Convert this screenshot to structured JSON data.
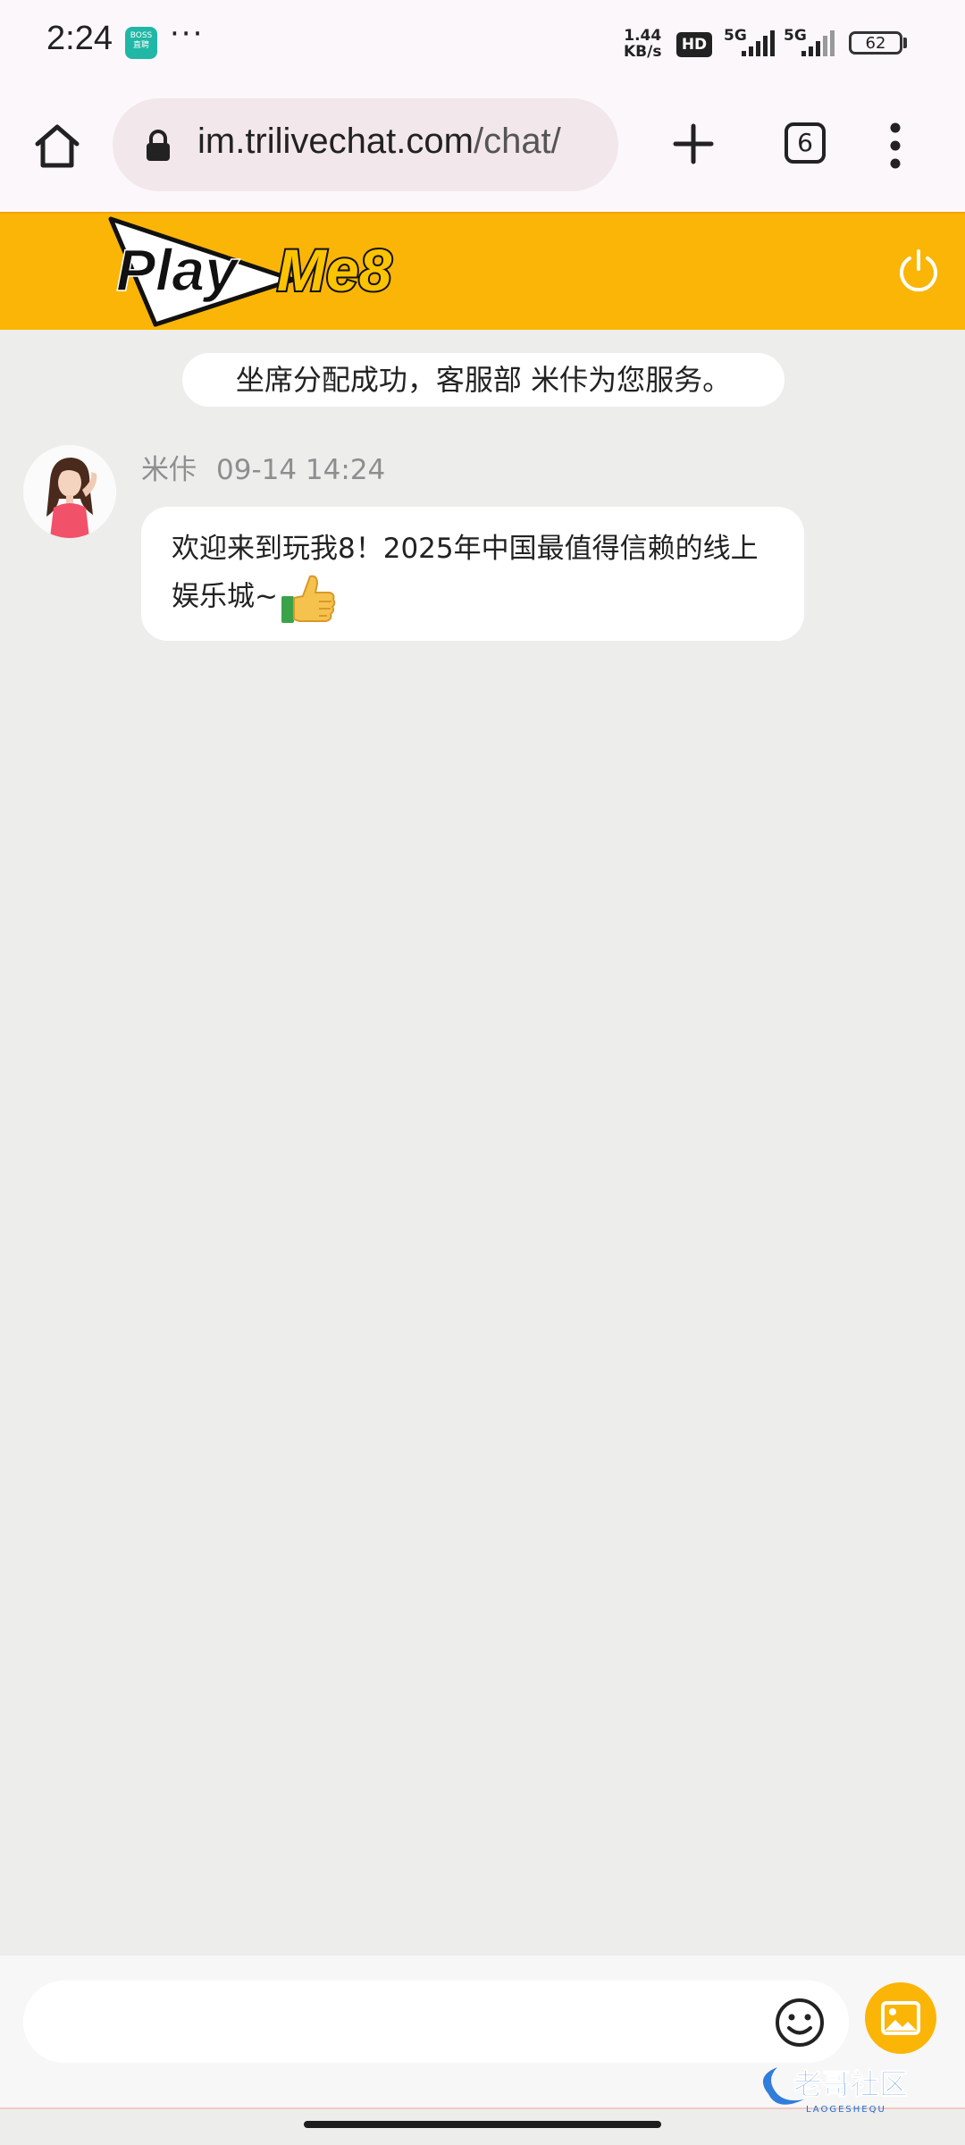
{
  "status_bar": {
    "time": "2:24",
    "notification_app": "BOSS\n直聘",
    "more": "···",
    "net_speed_top": "1.44",
    "net_speed_bottom": "KB/s",
    "hd": "HD",
    "signal_1": "5G",
    "signal_2": "5G",
    "battery": "62"
  },
  "browser": {
    "url_host": "im.trilivechat.com",
    "url_path": "/chat/",
    "tab_count": "6"
  },
  "chat_header": {
    "logo_text_1": "Play",
    "logo_text_2": "Me8",
    "brand_color": "#fbb507"
  },
  "chat": {
    "system_message": "坐席分配成功，客服部 米佧为您服务。",
    "agent_name": "米佧",
    "timestamp": "09-14 14:24",
    "message_line_1": "欢迎来到玩我8！2025年中国最值得信赖的线上",
    "message_line_2": "娱乐城~"
  },
  "input": {
    "placeholder": ""
  },
  "watermark": {
    "text": "老哥社区",
    "subtext": "LAOGESHEQU"
  }
}
